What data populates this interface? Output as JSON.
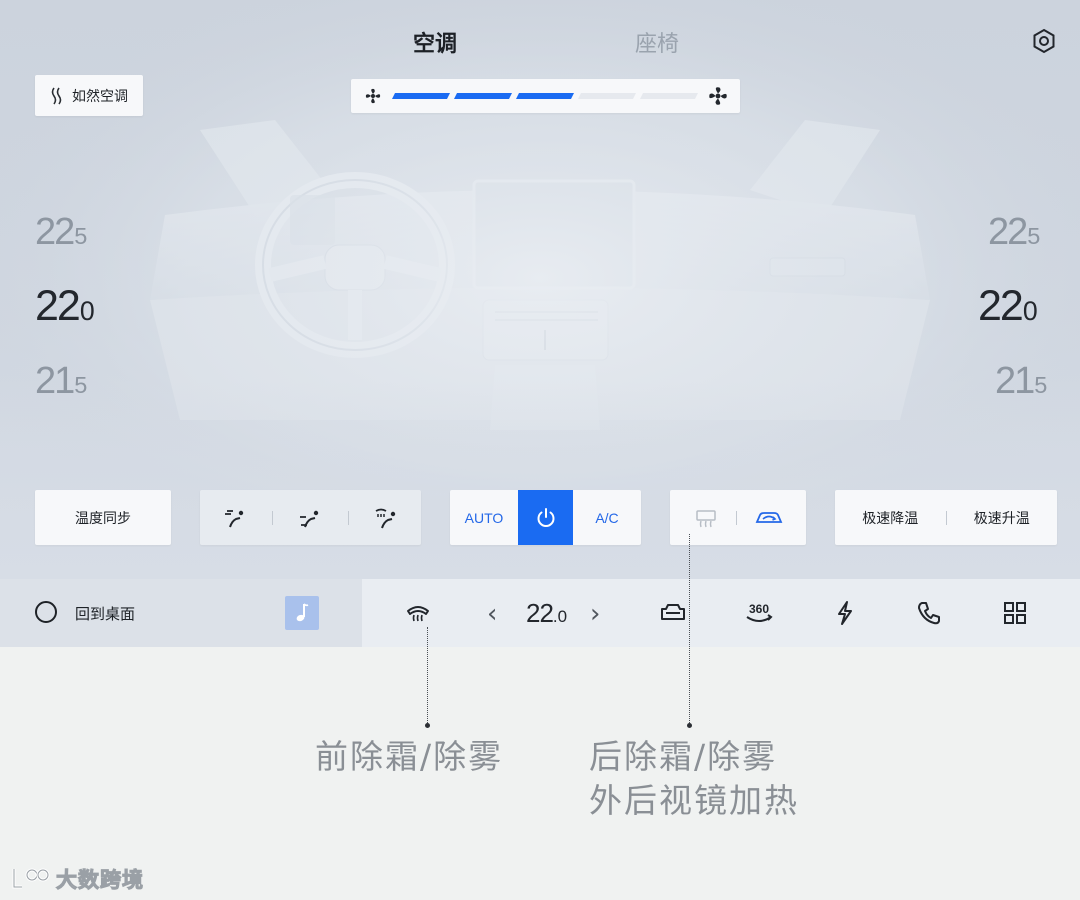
{
  "header": {
    "tabs": [
      {
        "label": "空调",
        "active": true
      },
      {
        "label": "座椅",
        "active": false
      }
    ],
    "settings_icon": "settings-hex-icon"
  },
  "climate": {
    "natural_button_label": "如然空调",
    "fan_speed": {
      "level": 3,
      "max": 5,
      "active_color": "#1a6bf2",
      "min_icon": "fan-small-icon",
      "max_icon": "fan-large-icon"
    },
    "left_temps": {
      "up": {
        "int": "22",
        "dec": "5"
      },
      "main": {
        "int": "22",
        "dec": "0"
      },
      "down": {
        "int": "21",
        "dec": "5"
      }
    },
    "right_temps": {
      "up": {
        "int": "22",
        "dec": "5"
      },
      "main": {
        "int": "22",
        "dec": "0"
      },
      "down": {
        "int": "21",
        "dec": "5"
      }
    }
  },
  "controls": {
    "sync_label": "温度同步",
    "airflow_modes": [
      "airflow-face-icon",
      "airflow-face-feet-icon",
      "airflow-windshield-feet-icon"
    ],
    "auto_label": "AUTO",
    "power_icon": "power-icon",
    "ac_label": "A/C",
    "rear_defrost_icon": "rear-defrost-icon",
    "recirculation_icon": "recirculation-icon",
    "rapid_cool_label": "极速降温",
    "rapid_heat_label": "极速升温",
    "accent_color": "#1a6bf2"
  },
  "dock": {
    "home_label": "回到桌面",
    "music_icon": "music-note-icon",
    "front_defrost_icon": "front-defrost-icon",
    "temp": {
      "int": "22",
      "dec": ".0"
    },
    "prev_symbol": "‹",
    "next_symbol": "›",
    "icons": [
      "car-seat-icon",
      "camera-360-icon",
      "charging-bolt-icon",
      "phone-icon",
      "app-grid-icon"
    ],
    "camera_label": "360"
  },
  "annotations": {
    "front_defrost": "前除霜/除雾",
    "rear_defrost_line1": "后除霜/除雾",
    "rear_defrost_line2": "外后视镜加热"
  },
  "watermark": {
    "text": "大数跨境"
  }
}
